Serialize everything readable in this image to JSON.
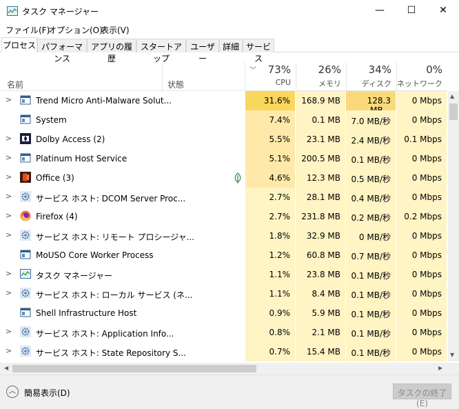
{
  "window": {
    "title": "タスク マネージャー",
    "minimize_glyph": "—",
    "maximize_glyph": "☐",
    "close_glyph": "✕"
  },
  "menu": [
    "ファイル(F)",
    "オプション(O)",
    "表示(V)"
  ],
  "tabs": [
    "プロセス",
    "パフォーマンス",
    "アプリの履歴",
    "スタートアップ",
    "ユーザー",
    "詳細",
    "サービス"
  ],
  "columns": {
    "name": "名前",
    "status": "状態",
    "cpu": {
      "label": "CPU",
      "percent": "73%"
    },
    "memory": {
      "label": "メモリ",
      "percent": "26%"
    },
    "disk": {
      "label": "ディスク",
      "percent": "34%"
    },
    "network": {
      "label": "ネットワーク",
      "percent": "0%"
    }
  },
  "colors": {
    "heat_low": "#fff4c4",
    "heat_mid": "#ffe9a8",
    "heat_high": "#f9d97a",
    "heat_top": "#f9d65c"
  },
  "processes": [
    {
      "name": "Trend Micro Anti-Malware Solut...",
      "expand": true,
      "icon": "app-window-icon",
      "cpu": "31.6%",
      "memory": "168.9 MB",
      "disk": "128.3 MB...",
      "network": "0 Mbps",
      "leaf": false
    },
    {
      "name": "System",
      "expand": false,
      "icon": "app-window-icon",
      "cpu": "7.4%",
      "memory": "0.1 MB",
      "disk": "7.0 MB/秒",
      "network": "0 Mbps",
      "leaf": false
    },
    {
      "name": "Dolby Access (2)",
      "expand": true,
      "icon": "dolby-icon",
      "cpu": "5.5%",
      "memory": "23.1 MB",
      "disk": "2.4 MB/秒",
      "network": "0.1 Mbps",
      "leaf": false
    },
    {
      "name": "Platinum Host Service",
      "expand": true,
      "icon": "app-window-icon",
      "cpu": "5.1%",
      "memory": "200.5 MB",
      "disk": "0.1 MB/秒",
      "network": "0 Mbps",
      "leaf": false
    },
    {
      "name": "Office (3)",
      "expand": true,
      "icon": "office-icon",
      "cpu": "4.6%",
      "memory": "12.3 MB",
      "disk": "0.5 MB/秒",
      "network": "0 Mbps",
      "leaf": true
    },
    {
      "name": "サービス ホスト: DCOM Server Proc...",
      "expand": true,
      "icon": "gear-icon",
      "cpu": "2.7%",
      "memory": "28.1 MB",
      "disk": "0.4 MB/秒",
      "network": "0 Mbps",
      "leaf": false
    },
    {
      "name": "Firefox (4)",
      "expand": true,
      "icon": "firefox-icon",
      "cpu": "2.7%",
      "memory": "231.8 MB",
      "disk": "0.2 MB/秒",
      "network": "0.2 Mbps",
      "leaf": false
    },
    {
      "name": "サービス ホスト: リモート プロシージャ...",
      "expand": true,
      "icon": "gear-icon",
      "cpu": "1.8%",
      "memory": "32.9 MB",
      "disk": "0 MB/秒",
      "network": "0 Mbps",
      "leaf": false
    },
    {
      "name": "MoUSO Core Worker Process",
      "expand": false,
      "icon": "app-window-icon",
      "cpu": "1.2%",
      "memory": "60.8 MB",
      "disk": "0.7 MB/秒",
      "network": "0 Mbps",
      "leaf": false
    },
    {
      "name": "タスク マネージャー",
      "expand": true,
      "icon": "task-manager-icon",
      "cpu": "1.1%",
      "memory": "23.8 MB",
      "disk": "0.1 MB/秒",
      "network": "0 Mbps",
      "leaf": false
    },
    {
      "name": "サービス ホスト: ローカル サービス (ネ...",
      "expand": true,
      "icon": "gear-icon",
      "cpu": "1.1%",
      "memory": "8.4 MB",
      "disk": "0.1 MB/秒",
      "network": "0 Mbps",
      "leaf": false
    },
    {
      "name": "Shell Infrastructure Host",
      "expand": false,
      "icon": "app-window-icon",
      "cpu": "0.9%",
      "memory": "5.9 MB",
      "disk": "0.1 MB/秒",
      "network": "0 Mbps",
      "leaf": false
    },
    {
      "name": "サービス ホスト: Application Info...",
      "expand": true,
      "icon": "gear-icon",
      "cpu": "0.8%",
      "memory": "2.1 MB",
      "disk": "0.1 MB/秒",
      "network": "0 Mbps",
      "leaf": false
    },
    {
      "name": "サービス ホスト: State Repository S...",
      "expand": true,
      "icon": "gear-icon",
      "cpu": "0.7%",
      "memory": "15.4 MB",
      "disk": "0.1 MB/秒",
      "network": "0 Mbps",
      "leaf": false
    }
  ],
  "footer": {
    "simple_view": "簡易表示(D)",
    "end_task": "タスクの終了(E)"
  }
}
